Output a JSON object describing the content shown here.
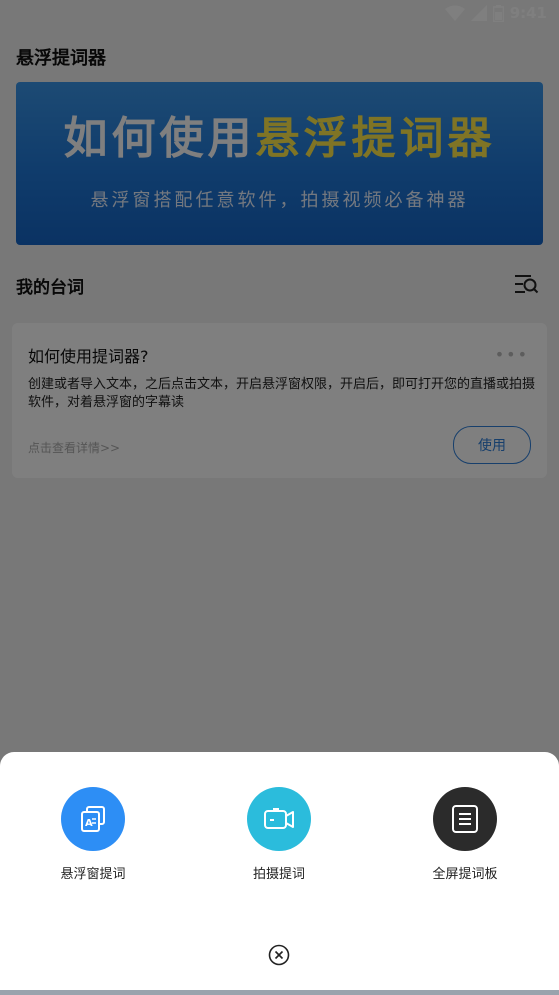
{
  "status_bar": {
    "time": "9:41"
  },
  "header": {
    "title": "悬浮提词器"
  },
  "banner": {
    "headline_white": "如何使用",
    "headline_yellow": "悬浮提词器",
    "subtitle": "悬浮窗搭配任意软件，拍摄视频必备神器"
  },
  "section": {
    "title": "我的台词",
    "icon": "list-search-icon"
  },
  "card": {
    "title": "如何使用提词器?",
    "more": "•••",
    "body": "创建或者导入文本，之后点击文本，开启悬浮窗权限，开启后，即可打开您的直播或拍摄软件，对着悬浮窗的字幕读",
    "detail_link": "点击查看详情>>",
    "use_button": "使用"
  },
  "sheet": {
    "actions": [
      {
        "label": "悬浮窗提词",
        "icon": "float-window-icon",
        "color": "#2d8ef5"
      },
      {
        "label": "拍摄提词",
        "icon": "camera-icon",
        "color": "#2bbcdc"
      },
      {
        "label": "全屏提词板",
        "icon": "fullscreen-board-icon",
        "color": "#2b2b2b"
      }
    ],
    "close_icon": "close-circle-icon"
  }
}
